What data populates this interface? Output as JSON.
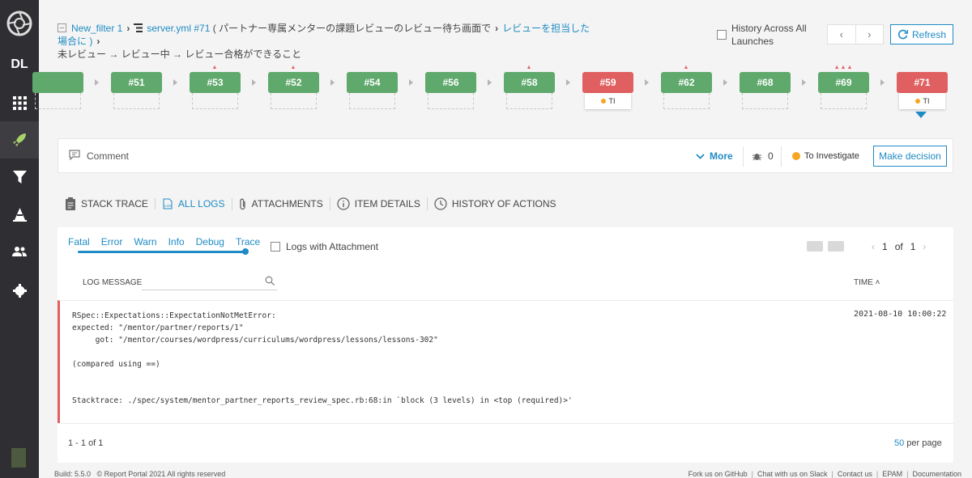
{
  "breadcrumb": {
    "filter": "New_filter 1",
    "launch": "server.yml #71",
    "suite": "( パートナー専属メンターの課題レビューのレビュー待ち画面で",
    "test": "レビューを担当した場合に )",
    "scenario": "未レビュー → レビュー中 → レビュー合格ができること"
  },
  "history_across": "History Across All Launches",
  "nav": {
    "prev": "‹",
    "next": "›"
  },
  "refresh": "Refresh",
  "history": [
    {
      "label": "",
      "status": "passed",
      "defects": 0,
      "ti": false
    },
    {
      "label": "#51",
      "status": "passed",
      "defects": 0,
      "ti": false
    },
    {
      "label": "#53",
      "status": "passed",
      "defects": 1,
      "ti": false
    },
    {
      "label": "#52",
      "status": "passed",
      "defects": 1,
      "ti": false
    },
    {
      "label": "#54",
      "status": "passed",
      "defects": 0,
      "ti": false
    },
    {
      "label": "#56",
      "status": "passed",
      "defects": 0,
      "ti": false
    },
    {
      "label": "#58",
      "status": "passed",
      "defects": 1,
      "ti": false
    },
    {
      "label": "#59",
      "status": "failed",
      "defects": 0,
      "ti": true
    },
    {
      "label": "#62",
      "status": "passed",
      "defects": 1,
      "ti": false
    },
    {
      "label": "#68",
      "status": "passed",
      "defects": 0,
      "ti": false
    },
    {
      "label": "#69",
      "status": "passed",
      "defects": 3,
      "ti": false
    },
    {
      "label": "#71",
      "status": "failed",
      "defects": 0,
      "ti": true
    }
  ],
  "ti_label": "TI",
  "comment_label": "Comment",
  "more": "More",
  "bug_count": "0",
  "defect_type": "To Investigate",
  "make_decision": "Make decision",
  "tabs": [
    "STACK TRACE",
    "ALL LOGS",
    "ATTACHMENTS",
    "ITEM DETAILS",
    "HISTORY OF ACTIONS"
  ],
  "levels": [
    "Fatal",
    "Error",
    "Warn",
    "Info",
    "Debug",
    "Trace"
  ],
  "logs_with_attachment": "Logs with Attachment",
  "pager": {
    "current": "1",
    "of": "of",
    "total": "1"
  },
  "table": {
    "col_message": "LOG MESSAGE",
    "col_time": "TIME"
  },
  "log": {
    "message": "RSpec::Expectations::ExpectationNotMetError:\nexpected: \"/mentor/partner/reports/1\"\n     got: \"/mentor/courses/wordpress/curriculums/wordpress/lessons/lessons-302\"\n\n(compared using ==)\n\n\nStacktrace: ./spec/system/mentor_partner_reports_review_spec.rb:68:in `block (3 levels) in <top (required)>'",
    "time": "2021-08-10 10:00:22"
  },
  "range": "1 - 1 of 1",
  "per_page": {
    "n": "50",
    "label": "per page"
  },
  "footer": {
    "build": "Build: 5.5.0",
    "copyright": "© Report Portal 2021 All rights reserved",
    "links": [
      "Fork us on GitHub",
      "Chat with us on Slack",
      "Contact us",
      "EPAM",
      "Documentation"
    ]
  },
  "sidebar_dl": "DL",
  "colors": {
    "accent": "#1f8bc4",
    "passed": "#5fa96d",
    "failed": "#e06061",
    "to_investigate": "#f5a623",
    "sidebar": "#2f2f33"
  }
}
